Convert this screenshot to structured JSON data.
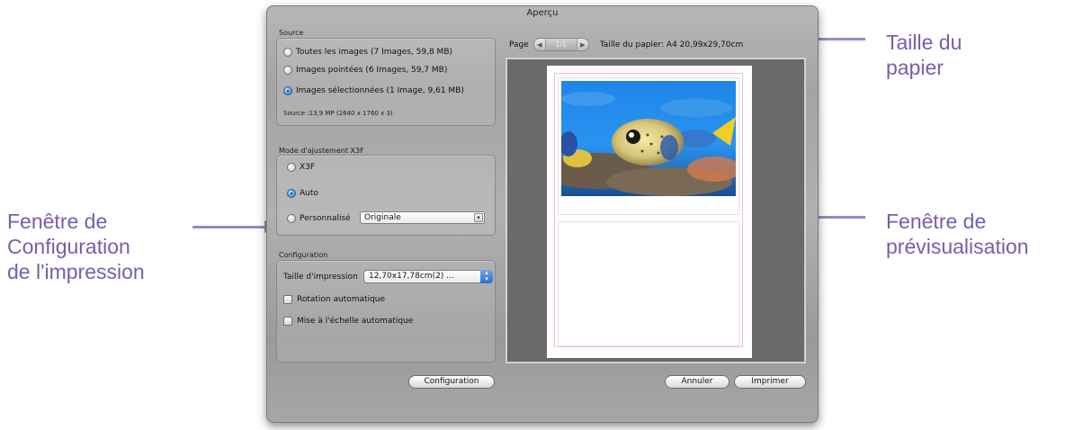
{
  "window": {
    "title": "Aperçu",
    "source": {
      "label": "Source",
      "options": [
        {
          "label": "Toutes les images  (7 Images, 59,8 MB)",
          "selected": false
        },
        {
          "label": "Images pointées  (6 Images, 59,7 MB)",
          "selected": false
        },
        {
          "label": "Images sélectionnées  (1 Image, 9,61 MB)",
          "selected": true
        }
      ],
      "info": "Source :13,9 MP (2640 x 1760 x 3)"
    },
    "mode": {
      "label": "Mode d'ajustement X3F",
      "options": [
        {
          "label": "X3F",
          "selected": false
        },
        {
          "label": "Auto",
          "selected": true
        },
        {
          "label": "Personnalisé",
          "selected": false
        }
      ],
      "custom_value": "Originale"
    },
    "config": {
      "label": "Configuration",
      "size_label": "Taille d'impression",
      "size_value": "12,70x17,78cm(2) ...",
      "rotation_label": "Rotation automatique",
      "scale_label": "Mise à l'échelle automatique"
    },
    "preview": {
      "page_label": "Page",
      "page_count": "1/1",
      "paper_info": "Taille du papier: A4  20,99x29,70cm"
    },
    "buttons": {
      "configuration": "Configuration",
      "cancel": "Annuler",
      "print": "Imprimer"
    }
  },
  "annotations": {
    "paper_size": [
      "Taille du",
      "papier"
    ],
    "preview_window": [
      "Fenêtre de",
      "prévisualisation"
    ],
    "print_config_window": [
      "Fenêtre de",
      "Configuration",
      "de l'impression"
    ]
  },
  "colors": {
    "annotation_text": "#7a5dab",
    "arrow": "#9b86c7",
    "selected_radio": "#2d6fc4"
  }
}
